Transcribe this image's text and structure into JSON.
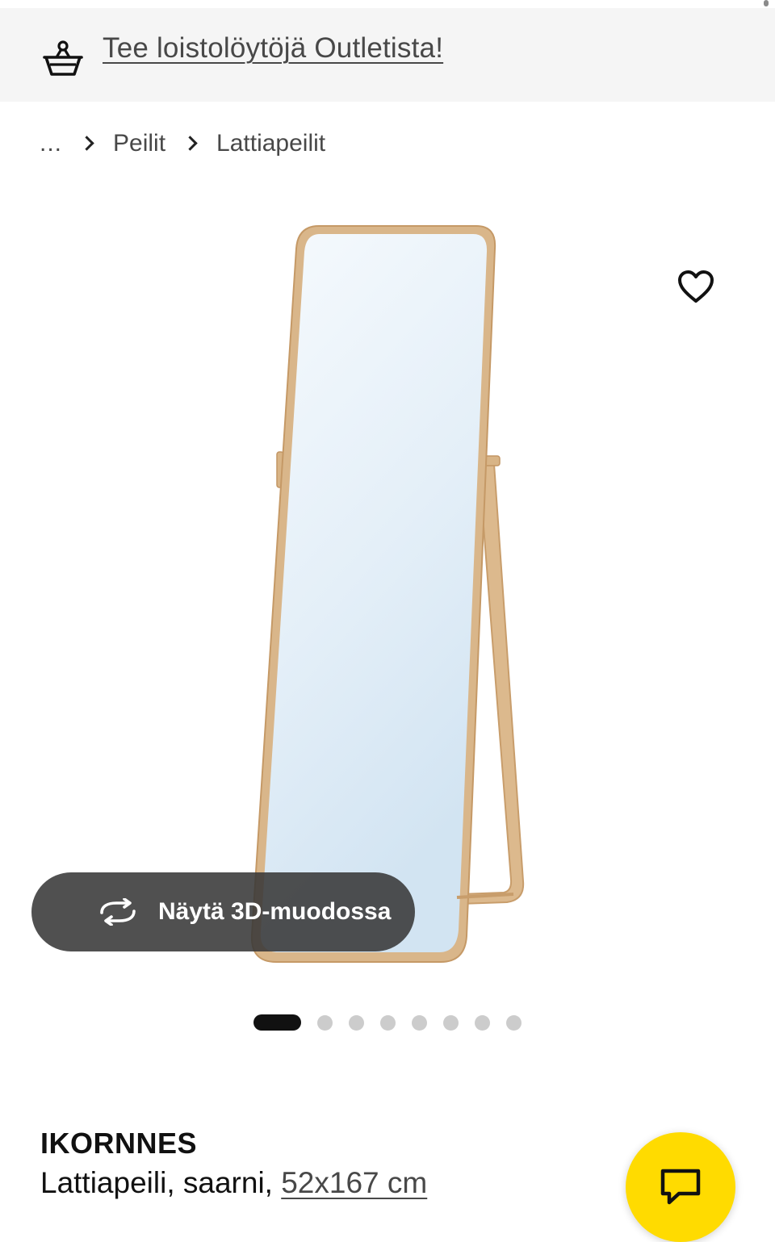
{
  "promo": {
    "icon": "basket-icon",
    "link_text": "Tee loistolöytöjä Outletista!"
  },
  "breadcrumb": {
    "ellipsis": "...",
    "items": [
      "Peilit",
      "Lattiapeilit"
    ]
  },
  "product_image": {
    "favorite_icon": "heart-icon",
    "view_3d_icon": "rotate-3d-icon",
    "view_3d_label": "Näytä 3D-muodossa"
  },
  "carousel": {
    "total_images": 8,
    "active_index": 0
  },
  "product": {
    "name": "IKORNNES",
    "description": "Lattiapeili, saarni, ",
    "size": "52x167 cm"
  },
  "chat": {
    "icon": "chat-icon",
    "accent_color": "#ffdb00"
  }
}
